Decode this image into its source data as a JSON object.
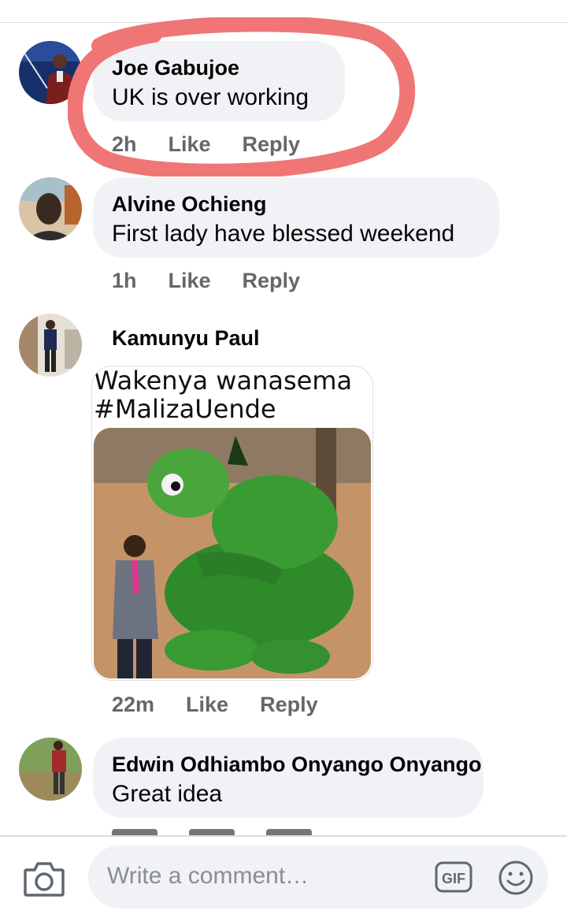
{
  "comments": [
    {
      "author": "Joe Gabujoe",
      "text": "UK is over working",
      "time": "2h",
      "like": "Like",
      "reply": "Reply"
    },
    {
      "author": "Alvine Ochieng",
      "text": "First lady have blessed weekend",
      "time": "1h",
      "like": "Like",
      "reply": "Reply"
    },
    {
      "author": "Kamunyu Paul",
      "meme_caption": "Wakenya wanasema\n#MalizaUende",
      "time": "22m",
      "like": "Like",
      "reply": "Reply"
    },
    {
      "author": "Edwin Odhiambo Onyango Onyango",
      "text": "Great idea"
    }
  ],
  "composer": {
    "placeholder": "Write a comment…",
    "gif_label": "GIF"
  },
  "icons": [
    "camera-icon",
    "gif-icon",
    "emoji-icon"
  ],
  "colors": {
    "bubble": "#f0f2f5",
    "meta_text": "#65676b",
    "annotation": "#f07575"
  }
}
